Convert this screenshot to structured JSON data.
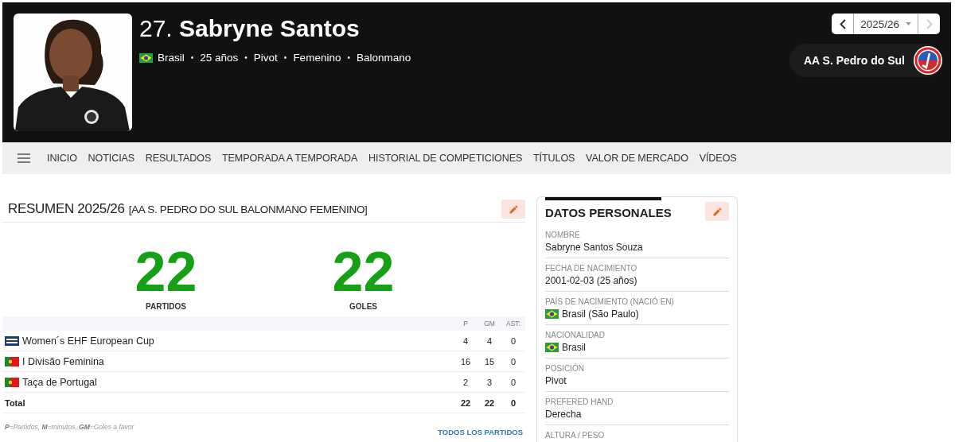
{
  "header": {
    "number": "27.",
    "name": "Sabryne Santos",
    "meta": [
      {
        "kind": "country",
        "text": "Brasil"
      },
      {
        "kind": "separator",
        "text": "•"
      },
      {
        "kind": "text",
        "text": "25 años"
      },
      {
        "kind": "separator",
        "text": "•"
      },
      {
        "kind": "text",
        "text": "Pivot"
      },
      {
        "kind": "separator",
        "text": "•"
      },
      {
        "kind": "text",
        "text": "Femenino"
      },
      {
        "kind": "separator",
        "text": "•"
      },
      {
        "kind": "text",
        "text": "Balonmano"
      }
    ],
    "season": {
      "value": "2025/26",
      "prev": {
        "disabled": false
      },
      "next": {
        "disabled": true
      }
    },
    "club": {
      "name": "AA S. Pedro do Sul"
    }
  },
  "nav": {
    "items": [
      "INICIO",
      "NOTICIAS",
      "RESULTADOS",
      "TEMPORADA A TEMPORADA",
      "HISTORIAL DE COMPETICIONES",
      "TÍTULOS",
      "VALOR DE MERCADO",
      "VÍDEOS"
    ]
  },
  "summary": {
    "title": "RESUMEN 2025/26",
    "subtitle": "[AA S. PEDRO DO SUL BALONMANO FEMENINO]",
    "stats": [
      {
        "value": "22",
        "label": "PARTIDOS"
      },
      {
        "value": "22",
        "label": "GOLES"
      }
    ],
    "table": {
      "columns": [
        "P",
        "GM",
        "AST:"
      ],
      "rows": [
        {
          "name": "Women´s EHF European Cup",
          "kind": "european",
          "cells": [
            "4",
            "4",
            "0"
          ]
        },
        {
          "name": "I Divisão Feminina",
          "kind": "national",
          "cells": [
            "16",
            "15",
            "0"
          ]
        },
        {
          "name": "Taça de Portugal",
          "kind": "national",
          "cells": [
            "2",
            "3",
            "0"
          ]
        }
      ],
      "total": {
        "name": "Total",
        "cells": [
          "22",
          "22",
          "0"
        ]
      }
    },
    "legend": "**P**=Partidos, **M**=minutos, **GM**=Goles a favor",
    "link": "TODOS LOS PARTIDOS"
  },
  "personal": {
    "title": "DATOS PERSONALES",
    "fields": [
      {
        "label": "NOMBRE",
        "value": "Sabryne Santos Souza"
      },
      {
        "label": "FECHA DE NACIMIENTO",
        "value": "2001-02-03 (25 años)"
      },
      {
        "label": "PAÍS DE NACIMIENTO (NACIÓ EN)",
        "value": "Brasil (São Paulo)",
        "kind": "country"
      },
      {
        "label": "NACIONALIDAD",
        "value": "Brasil",
        "kind": "country"
      },
      {
        "label": "POSICIÓN",
        "value": "Pivot"
      },
      {
        "label": "PREFERED HAND",
        "value": "Derecha"
      },
      {
        "label": "ALTURA / PESO"
      }
    ]
  }
}
